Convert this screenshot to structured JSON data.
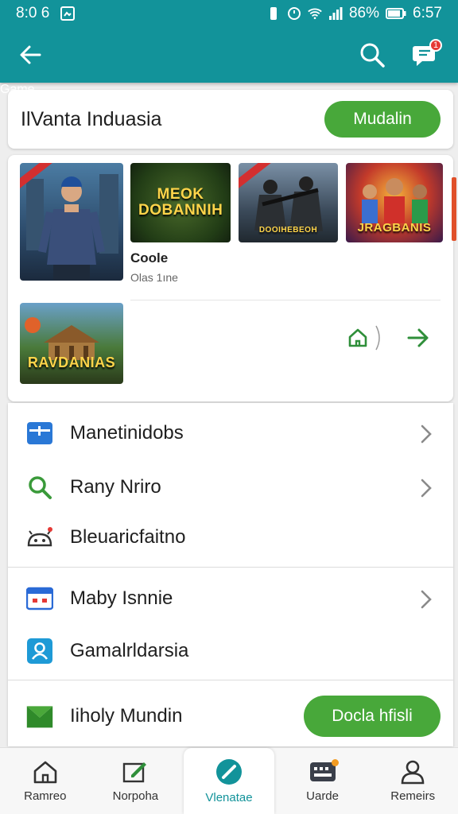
{
  "status_bar": {
    "time_left": "8:0 6",
    "battery": "86%",
    "time_right": "6:57"
  },
  "app_bar": {
    "title": "Game",
    "back_icon": "arrow-left-icon",
    "search_icon": "search-icon",
    "notification_icon": "chat-bell-icon",
    "notification_count": "1"
  },
  "header": {
    "label": "IlVanta Induasia",
    "button": "Mudalin"
  },
  "games": {
    "thumbs": [
      {
        "caption": ""
      },
      {
        "caption": "MEOK DOBANNIH"
      },
      {
        "caption": "DOOIHEBEOH"
      },
      {
        "caption": "JRAGBANIS"
      },
      {
        "caption": "RAVDANIAS"
      }
    ],
    "featured_title": "Coole",
    "featured_sub": "Olas 1ıne"
  },
  "menu": {
    "items": [
      {
        "label": "Manetinidobs"
      },
      {
        "label": "Rany Nriro"
      },
      {
        "label": "Bleuaricfaitno"
      },
      {
        "label": "Maby Isnnie"
      },
      {
        "label": "Gamalrldarsia"
      }
    ],
    "promo": {
      "label": "Iiholy Mundin",
      "button": "Docla hfisli"
    }
  },
  "bottom_nav": [
    {
      "label": "Ramreo",
      "icon": "home-icon"
    },
    {
      "label": "Norpoha",
      "icon": "edit-icon"
    },
    {
      "label": "Vlenatae",
      "icon": "compass-icon"
    },
    {
      "label": "Uarde",
      "icon": "gamepad-icon"
    },
    {
      "label": "Remeirs",
      "icon": "user-icon"
    }
  ],
  "colors": {
    "primary": "#12939a",
    "accent": "#48a83a",
    "badge": "#e53935"
  }
}
